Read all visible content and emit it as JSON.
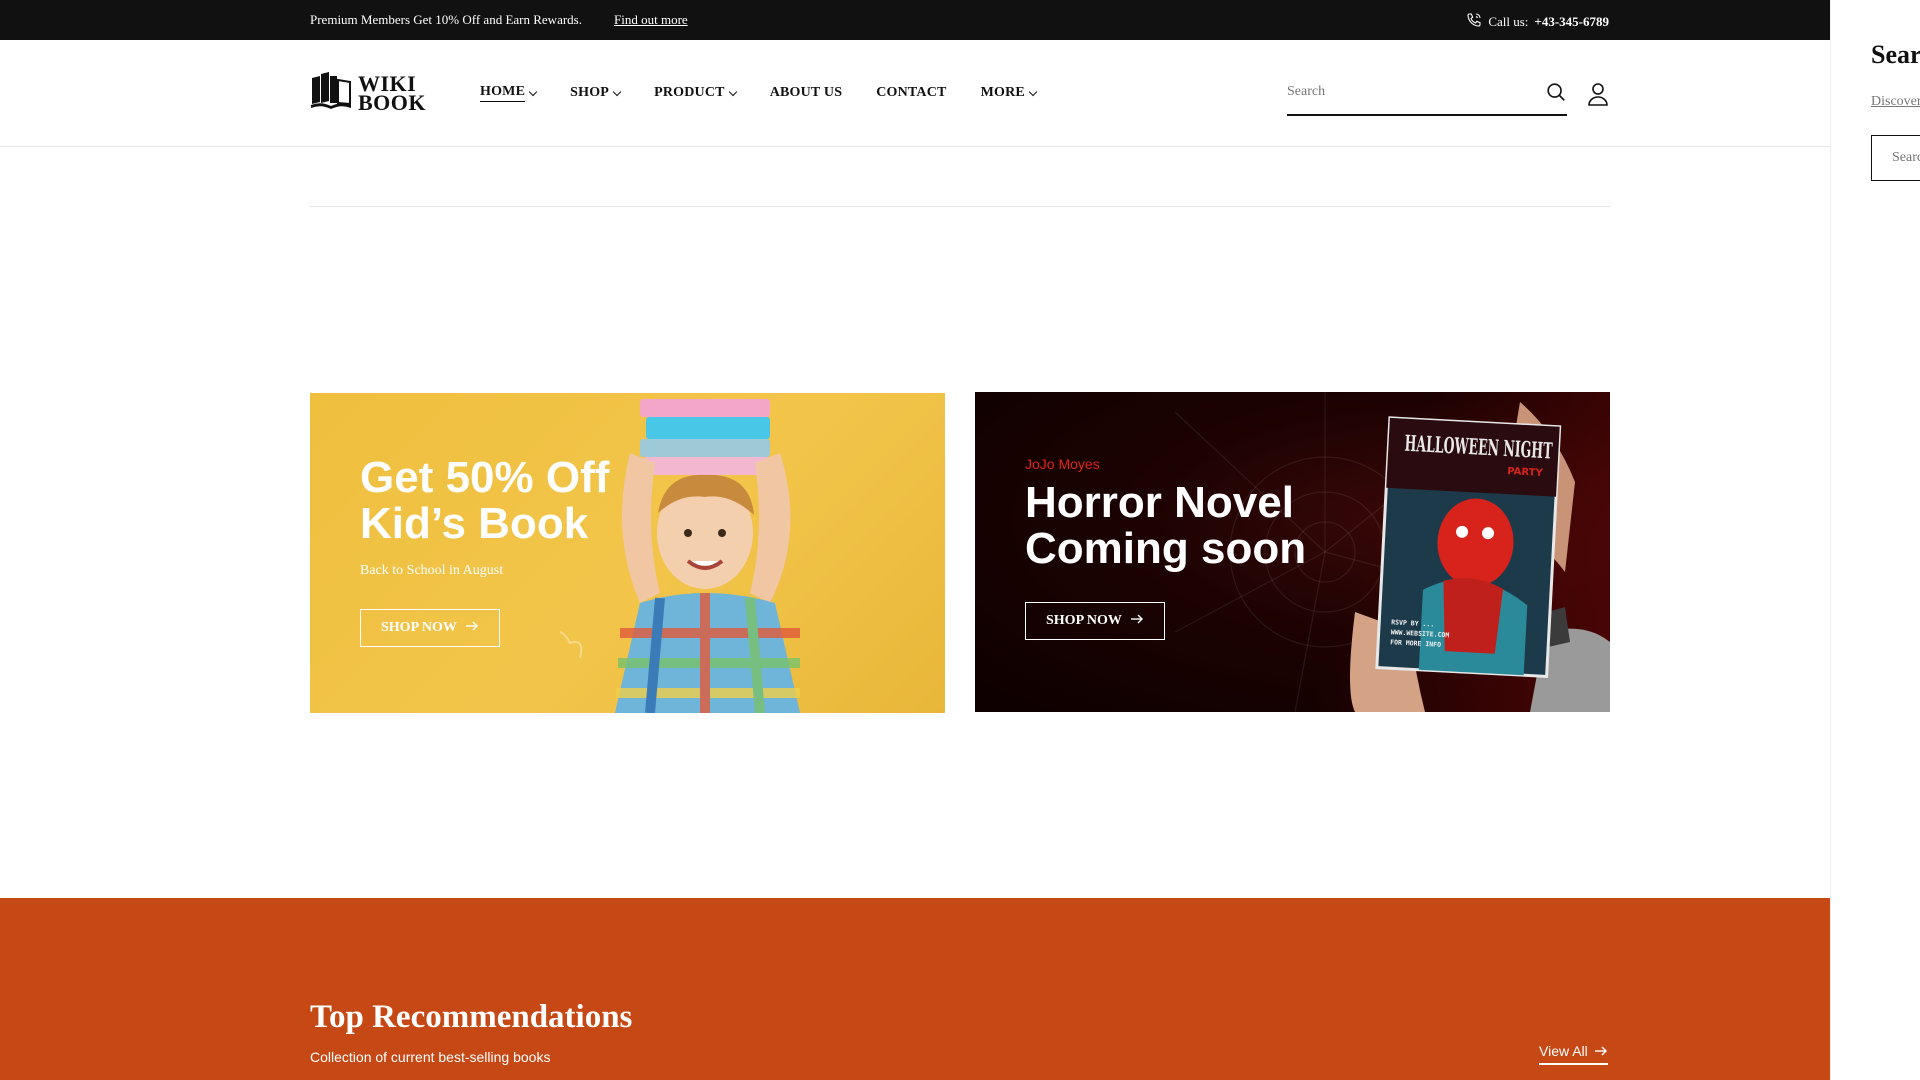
{
  "topbar": {
    "promo_text": "Premium Members Get 10% Off and Earn Rewards.",
    "promo_link": "Find out more",
    "call_label": "Call us:",
    "phone": "+43-345-6789",
    "phone_icon": "phone-icon"
  },
  "header": {
    "logo_line1": "WIKI",
    "logo_line2": "BOOK",
    "nav": [
      {
        "label": "HOME",
        "dropdown": true,
        "active": true
      },
      {
        "label": "SHOP",
        "dropdown": true
      },
      {
        "label": "PRODUCT",
        "dropdown": true
      },
      {
        "label": "ABOUT US",
        "dropdown": false
      },
      {
        "label": "CONTACT",
        "dropdown": false
      },
      {
        "label": "MORE",
        "dropdown": true
      }
    ],
    "search_placeholder": "Search",
    "search_icon": "search-icon",
    "user_icon": "user-icon"
  },
  "banners": [
    {
      "title_line1": "Get 50% Off",
      "title_line2": "Kid’s Book",
      "subtitle": "Back to School in August",
      "button": "SHOP NOW",
      "bg_color": "#F2C54A"
    },
    {
      "eyebrow": "JoJo Moyes",
      "title_line1": "Horror Novel",
      "title_line2": "Coming soon",
      "button": "SHOP NOW",
      "book_title": "HALLOWEEN NIGHT",
      "book_sub": "PARTY",
      "eyebrow_color": "#E0231C"
    }
  ],
  "recommendations": {
    "title": "Top Recommendations",
    "subtitle": "Collection of current best-selling books",
    "view_all": "View All",
    "bg_color": "#C64814"
  },
  "drawer": {
    "title": "Search",
    "link": "Discover",
    "input_placeholder": "Search"
  }
}
